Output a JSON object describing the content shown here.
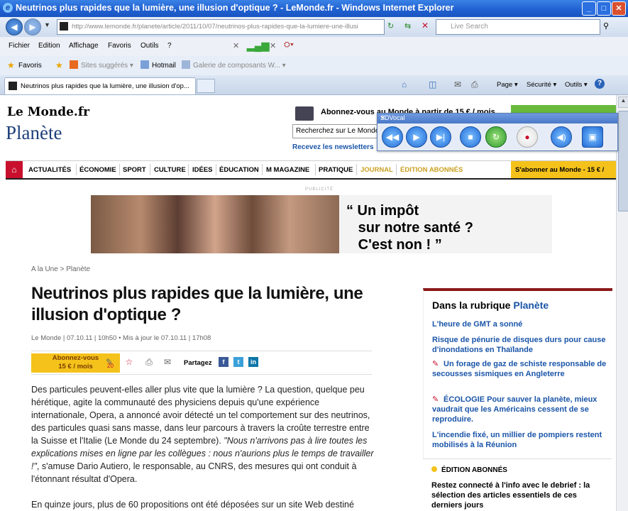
{
  "window": {
    "title": "Neutrinos plus rapides que la lumière, une illusion d'optique ? - LeMonde.fr - Windows Internet Explorer",
    "min": "_",
    "max": "□",
    "close": "✕"
  },
  "address": {
    "url": "http://www.lemonde.fr/planete/article/2011/10/07/neutrinos-plus-rapides-que-la-lumiere-une-illusi",
    "search_placeholder": "Live Search"
  },
  "menu": [
    "Fichier",
    "Edition",
    "Affichage",
    "Favoris",
    "Outils",
    "?"
  ],
  "favorites": {
    "favoris": "Favoris",
    "items": [
      "Sites suggérés ▾",
      "Hotmail",
      "Galerie de composants W... ▾"
    ]
  },
  "tab": {
    "label": "Neutrinos plus rapides que la lumière, une illusion d'op...",
    "tools": [
      "Page ▾",
      "Sécurité ▾",
      "Outils ▾"
    ]
  },
  "site": {
    "logo": "Le Monde.fr",
    "section": "Planète",
    "abonnez": "Abonnez-vous au Monde à partir de 15 € / mois",
    "search_placeholder": "Recherchez sur Le Monde",
    "newsletter": "Recevez les newsletters"
  },
  "nav": {
    "home": "⌂",
    "items": [
      "ACTUALITÉS",
      "ÉCONOMIE",
      "SPORT",
      "CULTURE",
      "IDÉES",
      "ÉDUCATION",
      "M MAGAZINE",
      "PRATIQUE"
    ],
    "journal": "JOURNAL",
    "abonnes": "ÉDITION ABONNÉS",
    "subscribe": "S'abonner au Monde - 15 € /"
  },
  "ad": {
    "label": "PUBLICITÉ",
    "text": "“ Un impôt\n   sur notre santé ?\n   C'est non ! ”"
  },
  "article": {
    "breadcrumb": "A la Une > Planète",
    "title": "Neutrinos plus rapides que la lumière, une illusion d'optique ?",
    "meta": "Le Monde | 07.10.11 | 10h50  •  Mis à jour le 07.10.11 | 17h08",
    "abonnez_btn": "Abonnez-vous\n15 € / mois",
    "comments": "20",
    "partagez": "Partagez",
    "p1": "Des particules peuvent-elles aller plus vite que la lumière ? La question, quelque peu hérétique, agite la communauté des physiciens depuis qu'une expérience internationale, Opera, a annoncé avoir détecté un tel comportement sur des neutrinos, des particules quasi sans masse, dans leur parcours à travers la croûte terrestre entre la Suisse et l'Italie (Le Monde du 24 septembre). ",
    "p1_quote": "\"Nous n'arrivons pas à lire toutes les explications mises en ligne par les collègues : nous n'aurions plus le temps de travailler !\"",
    "p1_end": ", s'amuse Dario Autiero, le responsable, au CNRS, des mesures qui ont conduit à l'étonnant résultat d'Opera.",
    "p2": "En quinze jours, plus de 60 propositions ont été déposées sur un site Web destiné"
  },
  "sidebar": {
    "title": "Dans la rubrique ",
    "title_link": "Planète",
    "links": [
      "L'heure de GMT a sonné",
      "Risque de pénurie de disques durs pour cause d'inondations en Thaïlande",
      "Un forage de gaz de schiste responsable de secousses sismiques en Angleterre",
      "ÉCOLOGIE  Pour sauver la planète, mieux vaudrait que les Américains cessent de se reproduire.",
      "L'incendie fixé, un millier de pompiers restent mobilisés à la Réunion"
    ],
    "abonnes_header": "ÉDITION ABONNÉS",
    "abonnes_text": "Restez connecté à l'info avec le debrief : la sélection des articles essentiels de ces derniers jours"
  },
  "widget": {
    "title": "SDVocal",
    "close": "✕"
  }
}
